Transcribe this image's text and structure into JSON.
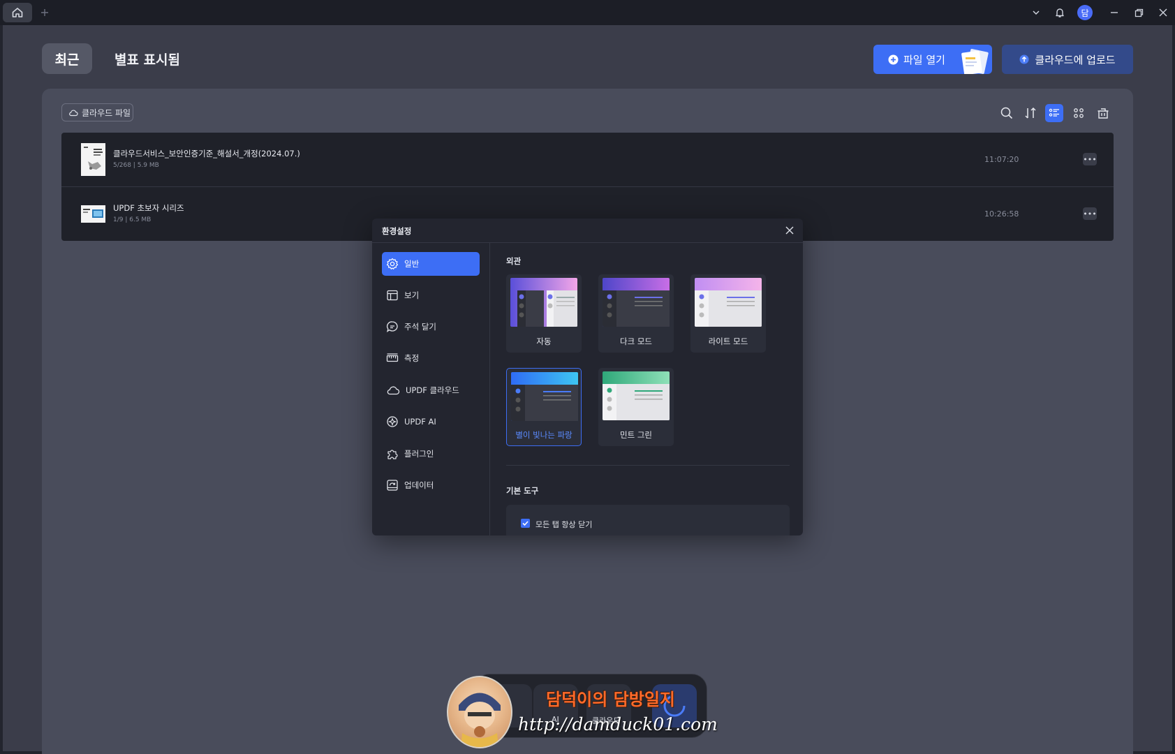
{
  "window": {
    "avatar_initial": "담"
  },
  "header": {
    "tab_recent": "최근",
    "tab_starred": "별표 표시됨",
    "open_file_label": "파일 열기",
    "upload_label": "클라우드에 업로드"
  },
  "panel": {
    "cloud_chip": "클라우드 파일",
    "active_view": "list",
    "files": [
      {
        "name": "클라우드서비스_보안인증기준_해설서_개정(2024.07.)",
        "meta": "5/268 | 5.9 MB",
        "time": "11:07:20"
      },
      {
        "name": "UPDF 초보자 시리즈",
        "meta": "1/9 | 6.5 MB",
        "time": "10:26:58"
      }
    ]
  },
  "modal": {
    "title": "환경설정",
    "sidebar": [
      {
        "label": "일반",
        "icon": "gear-icon",
        "active": true
      },
      {
        "label": "보기",
        "icon": "layout-icon"
      },
      {
        "label": "주석 달기",
        "icon": "comment-icon"
      },
      {
        "label": "측정",
        "icon": "ruler-icon"
      },
      {
        "label": "UPDF 클라우드",
        "icon": "cloud-icon"
      },
      {
        "label": "UPDF AI",
        "icon": "ai-icon"
      },
      {
        "label": "플러그인",
        "icon": "plugin-icon"
      },
      {
        "label": "업데이터",
        "icon": "update-icon"
      }
    ],
    "appearance_label": "외관",
    "themes": [
      {
        "name": "자동"
      },
      {
        "name": "다크 모드"
      },
      {
        "name": "라이트 모드"
      },
      {
        "name": "별이 빛나는 파랑",
        "selected": true
      },
      {
        "name": "민트 그린"
      }
    ],
    "basic_tools_label": "기본 도구",
    "option_close_tabs": "모든 탭 항상 닫기",
    "option_close_tabs_checked": true
  },
  "dock": {
    "ai_label": "AI",
    "cloud_label": "클라우드"
  },
  "watermark": {
    "title": "담덕이의 담방일지",
    "url": "http://damduck01.com"
  },
  "colors": {
    "accent": "#3d6ef5",
    "background": "#3b3d4a",
    "modal": "#23252f"
  }
}
